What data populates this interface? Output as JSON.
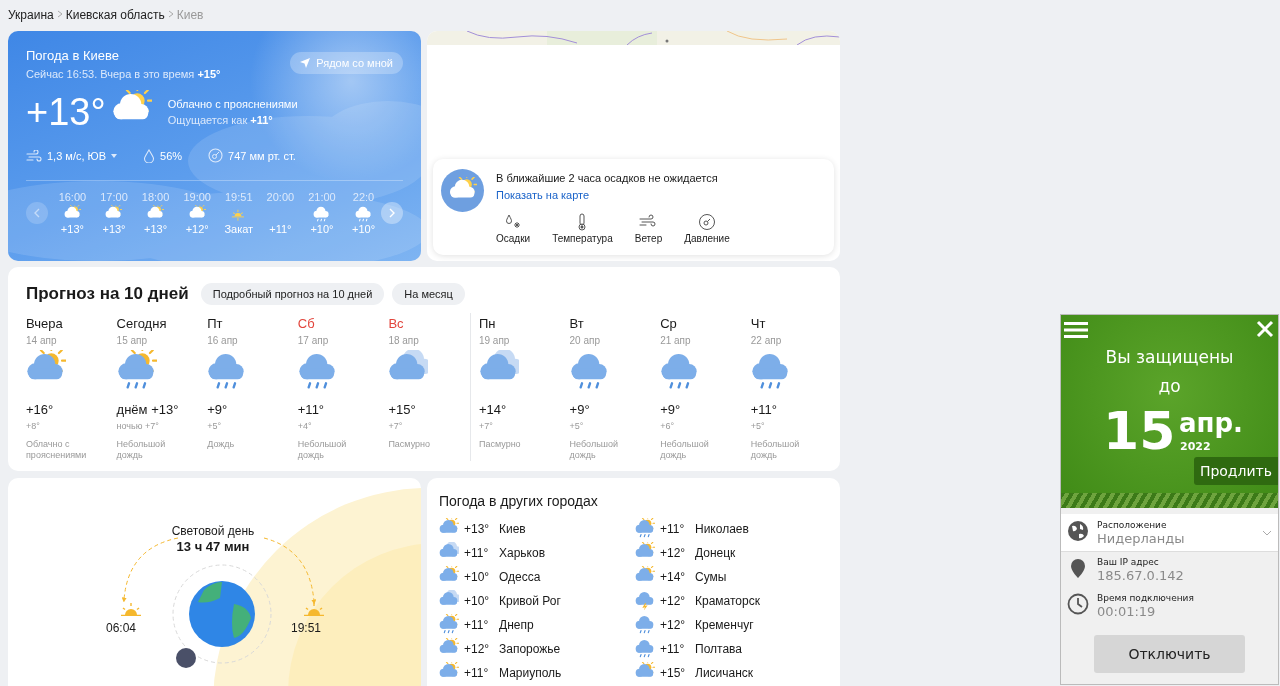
{
  "breadcrumbs": [
    {
      "label": "Украина",
      "current": false
    },
    {
      "label": "Киевская область",
      "current": false
    },
    {
      "label": "Киев",
      "current": true
    }
  ],
  "now": {
    "title": "Погода в Киеве",
    "subtitle": "Сейчас 16:53. Вчера в это время **+15°**",
    "nearby_button": "Рядом со мной",
    "temperature": "+13°",
    "kind": "partly-cloudy",
    "condition": "Облачно с прояснениями",
    "feels_like": "Ощущается как **+11°**",
    "wind": "1,3 м/с, ЮВ",
    "humidity": "56%",
    "pressure": "747 мм рт. ст.",
    "hours": [
      {
        "time": "16:00",
        "kind": "partly-cloudy",
        "value": "+13°"
      },
      {
        "time": "17:00",
        "kind": "partly-cloudy",
        "value": "+13°"
      },
      {
        "time": "18:00",
        "kind": "partly-cloudy",
        "value": "+13°"
      },
      {
        "time": "19:00",
        "kind": "partly-cloudy",
        "value": "+12°"
      },
      {
        "time": "19:51",
        "kind": "sunset",
        "value": "Закат"
      },
      {
        "time": "20:00",
        "kind": "none",
        "value": "+11°"
      },
      {
        "time": "21:00",
        "kind": "rain",
        "value": "+10°"
      },
      {
        "time": "22:0",
        "kind": "rain",
        "value": "+10°"
      }
    ]
  },
  "nowcast": {
    "message": "В ближайшие 2 часа осадков не ожидается",
    "link": "Показать на карте",
    "layers": [
      {
        "kind": "precipitation",
        "label": "Осадки"
      },
      {
        "kind": "temperature",
        "label": "Температура"
      },
      {
        "kind": "wind",
        "label": "Ветер"
      },
      {
        "kind": "pressure",
        "label": "Давление"
      }
    ]
  },
  "forecast": {
    "title": "Прогноз на 10 дней",
    "buttons": [
      "Подробный прогноз на 10 дней",
      "На месяц"
    ],
    "days": [
      {
        "name": "Вчера",
        "weekend": false,
        "week_start": false,
        "date": "14 апр",
        "kind": "partly-cloudy",
        "day": "+16°",
        "night": "+8°",
        "condition": "Облачно с прояснениями"
      },
      {
        "name": "Сегодня",
        "weekend": false,
        "week_start": false,
        "date": "15 апр",
        "kind": "partly-cloudy-rain",
        "day": "днём +13°",
        "night": "ночью +7°",
        "condition": "Небольшой дождь"
      },
      {
        "name": "Пт",
        "weekend": false,
        "week_start": false,
        "date": "16 апр",
        "kind": "rain",
        "day": "+9°",
        "night": "+5°",
        "condition": "Дождь"
      },
      {
        "name": "Сб",
        "weekend": true,
        "week_start": false,
        "date": "17 апр",
        "kind": "rain",
        "day": "+11°",
        "night": "+4°",
        "condition": "Небольшой дождь"
      },
      {
        "name": "Вс",
        "weekend": true,
        "week_start": false,
        "date": "18 апр",
        "kind": "overcast",
        "day": "+15°",
        "night": "+7°",
        "condition": "Пасмурно"
      },
      {
        "name": "Пн",
        "weekend": false,
        "week_start": true,
        "date": "19 апр",
        "kind": "overcast",
        "day": "+14°",
        "night": "+7°",
        "condition": "Пасмурно"
      },
      {
        "name": "Вт",
        "weekend": false,
        "week_start": false,
        "date": "20 апр",
        "kind": "rain",
        "day": "+9°",
        "night": "+5°",
        "condition": "Небольшой дождь"
      },
      {
        "name": "Ср",
        "weekend": false,
        "week_start": false,
        "date": "21 апр",
        "kind": "rain",
        "day": "+9°",
        "night": "+6°",
        "condition": "Небольшой дождь"
      },
      {
        "name": "Чт",
        "weekend": false,
        "week_start": false,
        "date": "22 апр",
        "kind": "rain",
        "day": "+11°",
        "night": "+5°",
        "condition": "Небольшой дождь"
      }
    ]
  },
  "daylight": {
    "label": "Световой день",
    "duration": "13 ч 47 мин",
    "sunrise": "06:04",
    "sunset": "19:51"
  },
  "cities": {
    "title": "Погода в других городах",
    "items": [
      {
        "temp": "+13°",
        "name": "Киев",
        "kind": "partly-cloudy"
      },
      {
        "temp": "+11°",
        "name": "Харьков",
        "kind": "overcast"
      },
      {
        "temp": "+10°",
        "name": "Одесса",
        "kind": "partly-cloudy"
      },
      {
        "temp": "+10°",
        "name": "Кривой Рог",
        "kind": "overcast"
      },
      {
        "temp": "+11°",
        "name": "Днепр",
        "kind": "partly-cloudy-rain"
      },
      {
        "temp": "+12°",
        "name": "Запорожье",
        "kind": "partly-cloudy"
      },
      {
        "temp": "+11°",
        "name": "Мариуполь",
        "kind": "partly-cloudy"
      },
      {
        "temp": "+11°",
        "name": "Николаев",
        "kind": "partly-cloudy-rain"
      },
      {
        "temp": "+12°",
        "name": "Донецк",
        "kind": "partly-cloudy"
      },
      {
        "temp": "+14°",
        "name": "Сумы",
        "kind": "partly-cloudy"
      },
      {
        "temp": "+12°",
        "name": "Краматорск",
        "kind": "thunderstorm"
      },
      {
        "temp": "+12°",
        "name": "Кременчуг",
        "kind": "rain"
      },
      {
        "temp": "+11°",
        "name": "Полтава",
        "kind": "rain"
      },
      {
        "temp": "+15°",
        "name": "Лисичанск",
        "kind": "partly-cloudy"
      }
    ]
  },
  "vpn": {
    "headline": "Вы защищены",
    "until": "до",
    "day": "15",
    "month": "апр.",
    "year": "2022",
    "renew_button": "Продлить",
    "rows": [
      {
        "kind": "location",
        "label": "Расположение",
        "value": "Нидерланды"
      },
      {
        "kind": "ip",
        "label": "Ваш IP адрес",
        "value": "185.67.0.142"
      },
      {
        "kind": "time",
        "label": "Время подключения",
        "value": "00:01:19"
      }
    ],
    "disconnect_button": "Отключить"
  }
}
